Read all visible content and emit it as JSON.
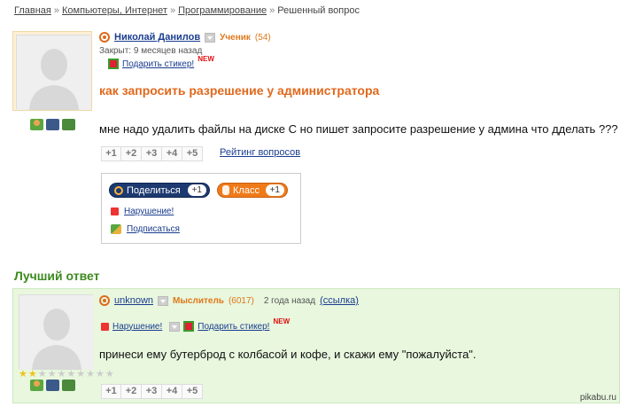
{
  "breadcrumb": {
    "items": [
      "Главная",
      "Компьютеры, Интернет",
      "Программирование"
    ],
    "current": "Решенный вопрос"
  },
  "question": {
    "user": {
      "name": "Николай Данилов",
      "rank": "Ученик",
      "points": "(54)"
    },
    "closed": "Закрыт: 9 месяцев назад",
    "gift": "Подарить стикер!",
    "new_badge": "NEW",
    "title": "как запросить разрешение у администратора",
    "body": "мне надо удалить файлы на диске С но пишет запросите разрешение у админа что дделать ???",
    "votes": [
      "+1",
      "+2",
      "+3",
      "+4",
      "+5"
    ],
    "rating_link": "Рейтинг вопросов"
  },
  "share": {
    "mail_label": "Поделиться",
    "mail_count": "+1",
    "ok_label": "Класс",
    "ok_count": "+1",
    "violation": "Нарушение!",
    "subscribe": "Подписаться"
  },
  "best_answer": {
    "heading": "Лучший ответ",
    "user": {
      "name": "unknown",
      "rank": "Мыслитель",
      "points": "(6017)"
    },
    "time": "2 года назад",
    "link": "(ссылка)",
    "violation": "Нарушение!",
    "gift": "Подарить стикер!",
    "new_badge": "NEW",
    "body": "принеси ему бутерброд с колбасой и кофе, и скажи ему \"пожалуйста\".",
    "votes": [
      "+1",
      "+2",
      "+3",
      "+4",
      "+5"
    ],
    "stars_on": 2,
    "stars_total": 10
  },
  "icons": {
    "user_icons": [
      "user-status-icon",
      "camera-icon",
      "video-icon"
    ],
    "accent_orange": "#e0691d",
    "accent_green": "#3c8a1e",
    "link_blue": "#1a3d8f"
  },
  "watermark": "pikabu.ru"
}
